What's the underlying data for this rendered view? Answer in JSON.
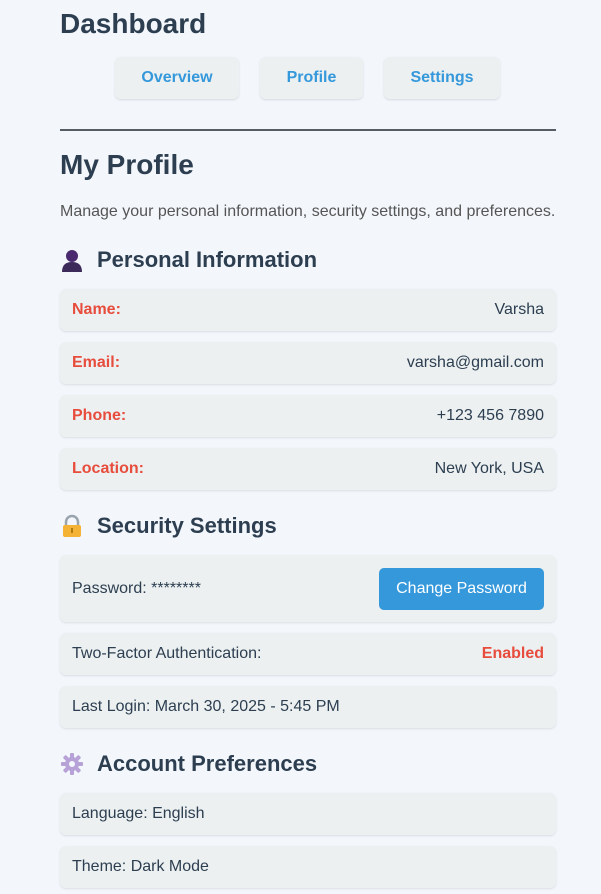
{
  "app": {
    "title": "Dashboard"
  },
  "nav": {
    "items": [
      {
        "label": "Overview"
      },
      {
        "label": "Profile"
      },
      {
        "label": "Settings"
      }
    ]
  },
  "page": {
    "title": "My Profile",
    "subtitle": "Manage your personal information, security settings, and preferences."
  },
  "personal": {
    "heading": "Personal Information",
    "icon": "person-icon",
    "rows": [
      {
        "label": "Name:",
        "value": "Varsha"
      },
      {
        "label": "Email:",
        "value": "varsha@gmail.com"
      },
      {
        "label": "Phone:",
        "value": "+123 456 7890"
      },
      {
        "label": "Location:",
        "value": "New York, USA"
      }
    ]
  },
  "security": {
    "heading": "Security Settings",
    "icon": "lock-icon",
    "password_text": "Password: ********",
    "change_password_label": "Change Password",
    "two_factor_label": "Two-Factor Authentication:",
    "two_factor_status": "Enabled",
    "last_login": "Last Login: March 30, 2025 - 5:45 PM"
  },
  "preferences": {
    "heading": "Account Preferences",
    "icon": "gear-icon",
    "language": "Language: English",
    "theme": "Theme: Dark Mode"
  },
  "colors": {
    "background": "#f3f7fc",
    "card": "#ecf0f1",
    "accent": "#3498db",
    "label_red": "#e74c3c",
    "text_dark": "#2c3e50"
  }
}
